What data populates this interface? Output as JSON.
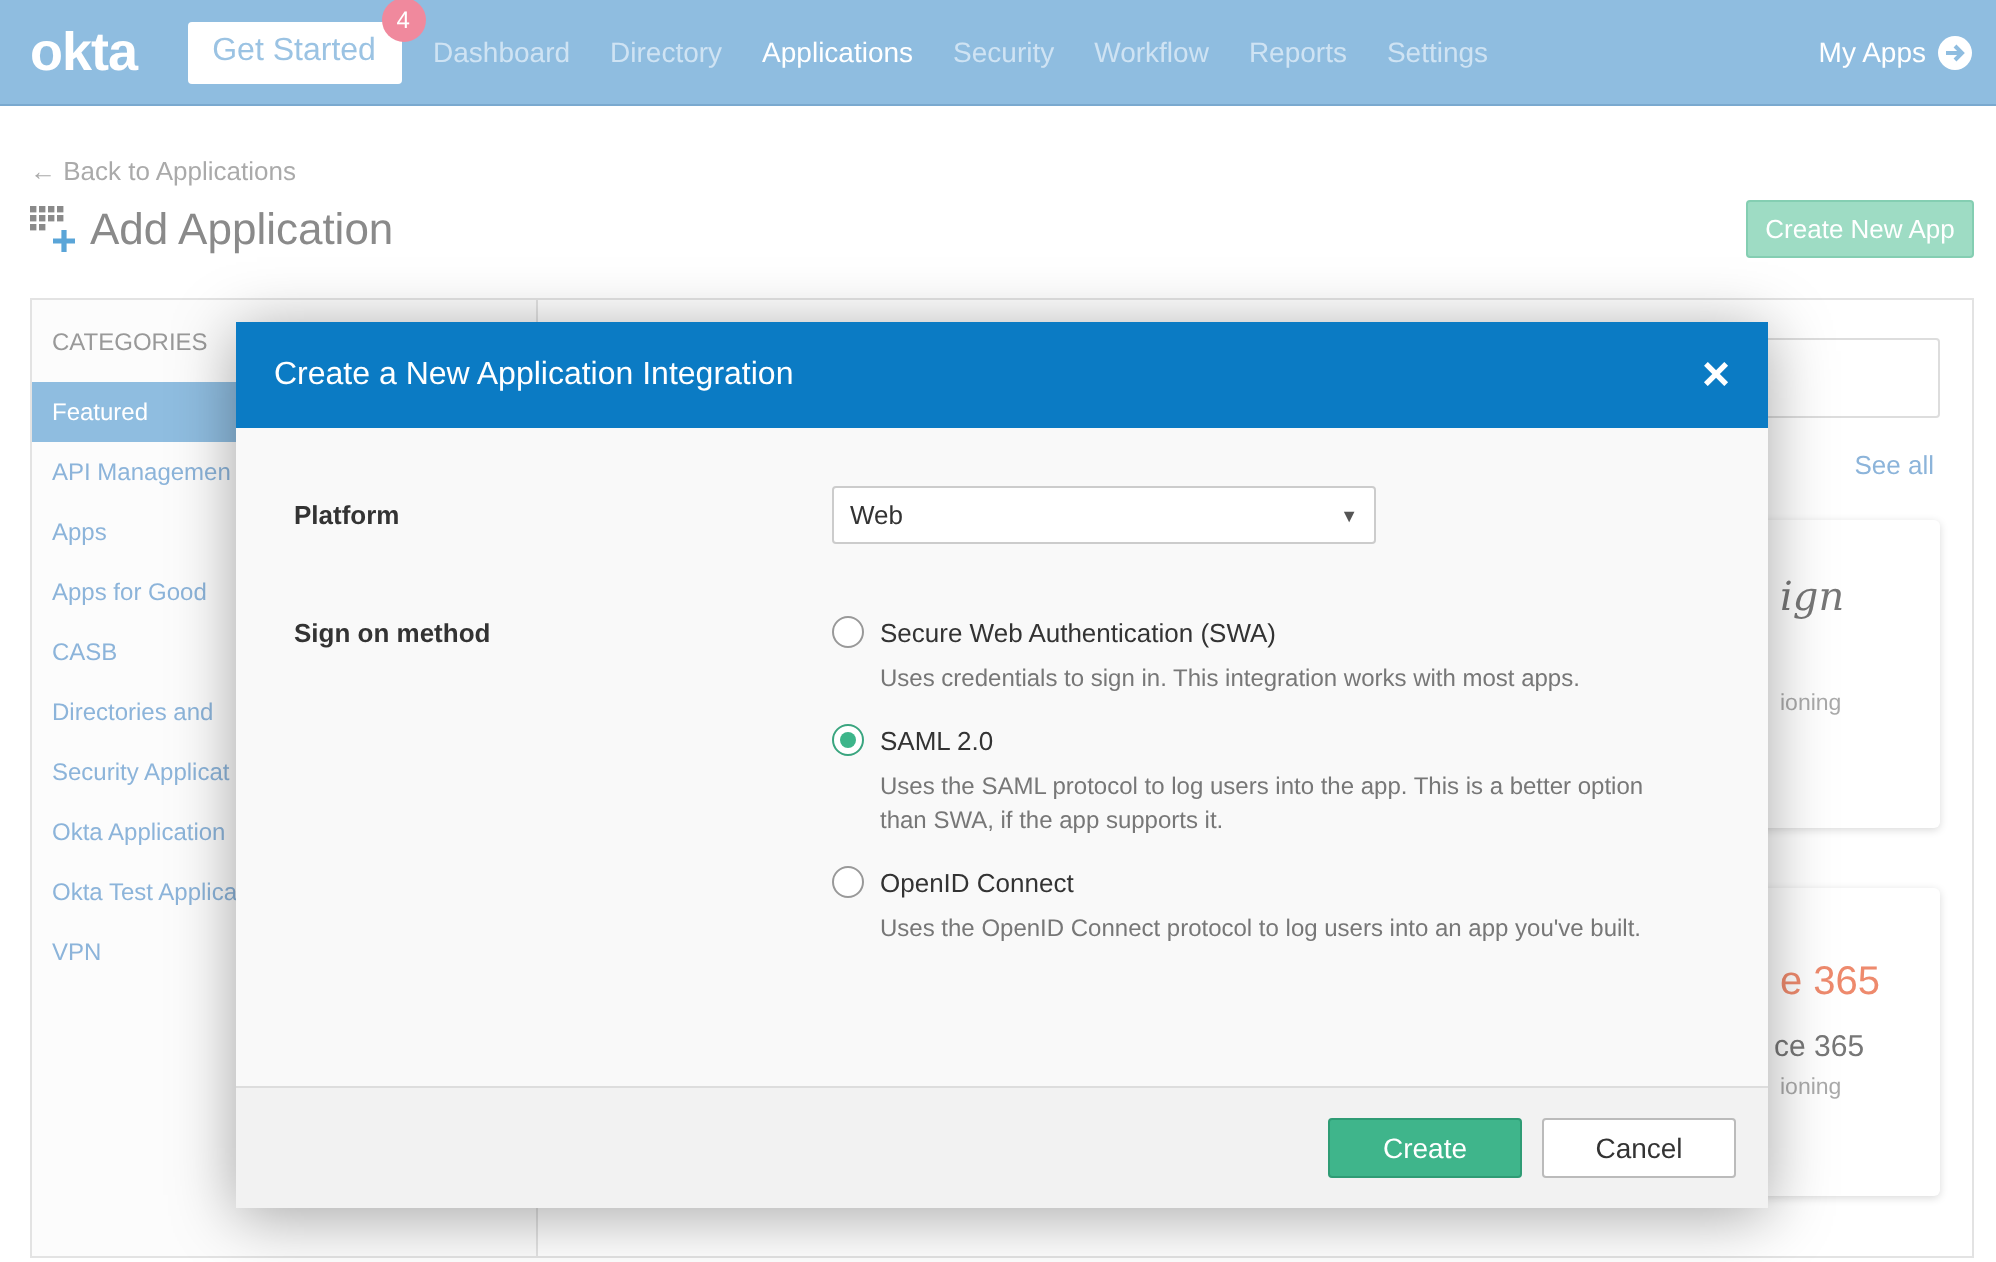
{
  "header": {
    "logo": "okta",
    "get_started": {
      "label": "Get Started",
      "badge": "4"
    },
    "nav": [
      {
        "label": "Dashboard",
        "selected": false
      },
      {
        "label": "Directory",
        "selected": false
      },
      {
        "label": "Applications",
        "selected": true
      },
      {
        "label": "Security",
        "selected": false
      },
      {
        "label": "Workflow",
        "selected": false
      },
      {
        "label": "Reports",
        "selected": false
      },
      {
        "label": "Settings",
        "selected": false
      }
    ],
    "my_apps": "My Apps"
  },
  "page": {
    "back_link": "← Back to Applications",
    "title": "Add Application",
    "create_button": "Create New App"
  },
  "sidebar": {
    "heading": "CATEGORIES",
    "items": [
      {
        "label": "Featured",
        "selected": true
      },
      {
        "label": "API Managemen",
        "selected": false
      },
      {
        "label": "Apps",
        "selected": false
      },
      {
        "label": "Apps for Good",
        "selected": false
      },
      {
        "label": "CASB",
        "selected": false
      },
      {
        "label": "Directories and",
        "selected": false
      },
      {
        "label": "Security Applicat",
        "selected": false
      },
      {
        "label": "Okta Application",
        "selected": false
      },
      {
        "label": "Okta Test Applica",
        "selected": false
      },
      {
        "label": "VPN",
        "selected": false
      }
    ]
  },
  "main": {
    "see_all": "See all",
    "cards": [
      {
        "logo": "ign",
        "kind": "script",
        "caption": "ioning"
      },
      {
        "logo": "e 365",
        "kind": "brand",
        "name": "ce 365",
        "caption": "ioning"
      }
    ]
  },
  "dialog": {
    "title": "Create a New Application Integration",
    "close": "×",
    "platform": {
      "label": "Platform",
      "value": "Web",
      "caret": "▼"
    },
    "sign_on": {
      "label": "Sign on method",
      "options": [
        {
          "label": "Secure Web Authentication (SWA)",
          "description": "Uses credentials to sign in. This integration works with most apps.",
          "selected": false
        },
        {
          "label": "SAML 2.0",
          "description": "Uses the SAML protocol to log users into the app. This is a better option than SWA, if the app supports it.",
          "selected": true
        },
        {
          "label": "OpenID Connect",
          "description": "Uses the OpenID Connect protocol to log users into an app you've built.",
          "selected": false
        }
      ]
    },
    "buttons": [
      {
        "label": "Create",
        "kind": "primary"
      },
      {
        "label": "Cancel",
        "kind": "secondary"
      }
    ]
  }
}
